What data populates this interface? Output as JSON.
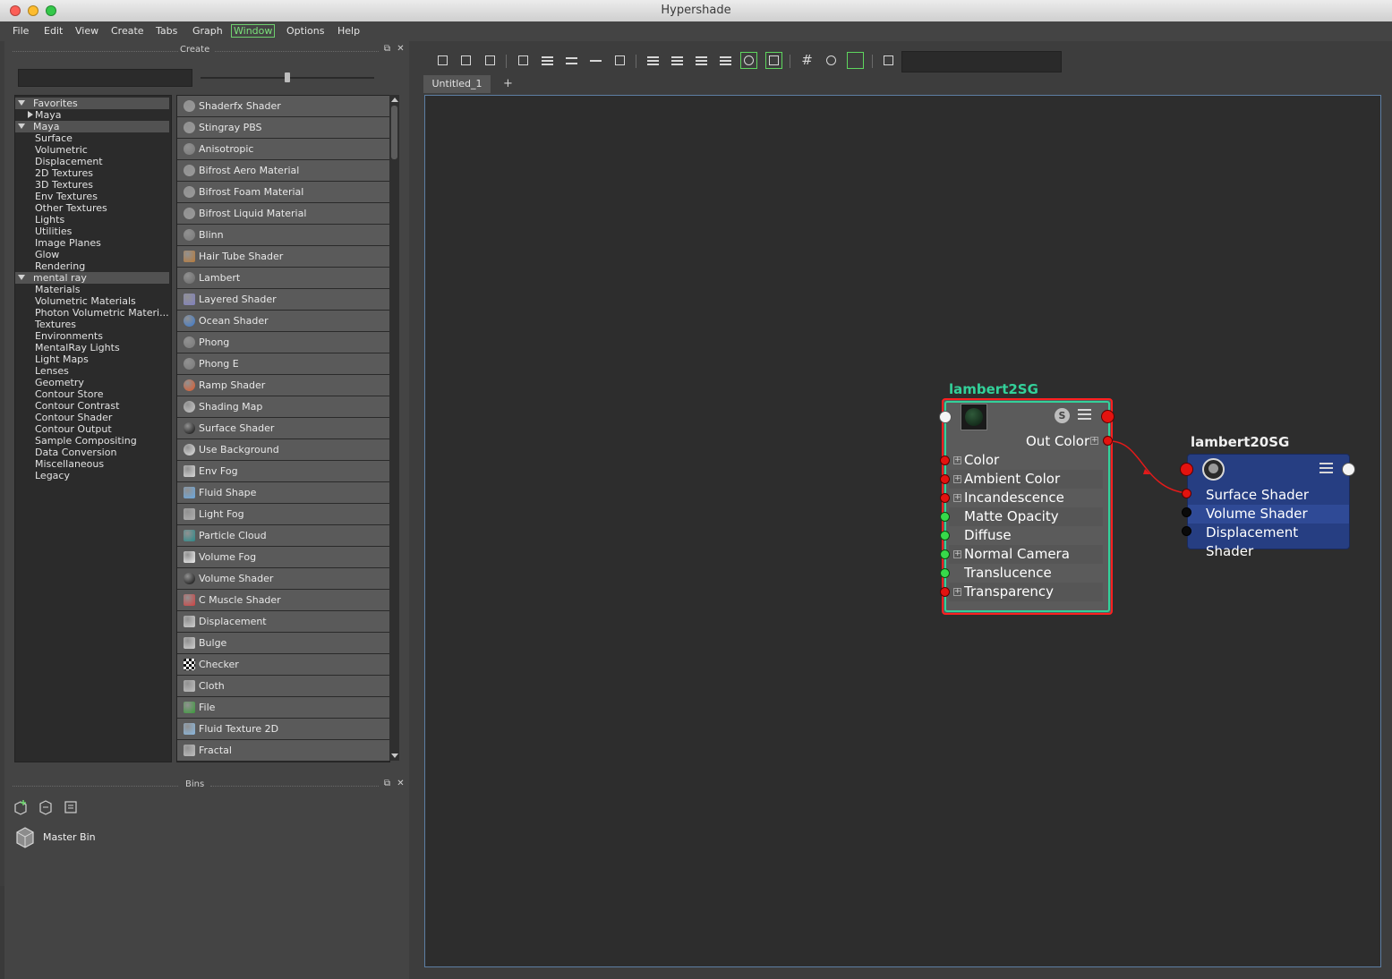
{
  "window": {
    "title": "Hypershade"
  },
  "menu": [
    "File",
    "Edit",
    "View",
    "Create",
    "Tabs",
    "Graph",
    "Window",
    "Options",
    "Help"
  ],
  "create_panel": {
    "title": "Create",
    "tree": [
      {
        "label": "Favorites",
        "level": 0,
        "expanded": true
      },
      {
        "label": "Maya",
        "level": 1,
        "expanded": false
      },
      {
        "label": "Maya",
        "level": 0,
        "expanded": true
      },
      {
        "label": "Surface",
        "level": 1
      },
      {
        "label": "Volumetric",
        "level": 1
      },
      {
        "label": "Displacement",
        "level": 1
      },
      {
        "label": "2D Textures",
        "level": 1
      },
      {
        "label": "3D Textures",
        "level": 1
      },
      {
        "label": "Env Textures",
        "level": 1
      },
      {
        "label": "Other Textures",
        "level": 1
      },
      {
        "label": "Lights",
        "level": 1
      },
      {
        "label": "Utilities",
        "level": 1
      },
      {
        "label": "Image Planes",
        "level": 1
      },
      {
        "label": "Glow",
        "level": 1
      },
      {
        "label": "Rendering",
        "level": 1
      },
      {
        "label": "mental ray",
        "level": 0,
        "expanded": true
      },
      {
        "label": "Materials",
        "level": 1
      },
      {
        "label": "Volumetric Materials",
        "level": 1
      },
      {
        "label": "Photon Volumetric Materi...",
        "level": 1
      },
      {
        "label": "Textures",
        "level": 1
      },
      {
        "label": "Environments",
        "level": 1
      },
      {
        "label": "MentalRay Lights",
        "level": 1
      },
      {
        "label": "Light Maps",
        "level": 1
      },
      {
        "label": "Lenses",
        "level": 1
      },
      {
        "label": "Geometry",
        "level": 1
      },
      {
        "label": "Contour Store",
        "level": 1
      },
      {
        "label": "Contour Contrast",
        "level": 1
      },
      {
        "label": "Contour Shader",
        "level": 1
      },
      {
        "label": "Contour Output",
        "level": 1
      },
      {
        "label": "Sample Compositing",
        "level": 1
      },
      {
        "label": "Data Conversion",
        "level": 1
      },
      {
        "label": "Miscellaneous",
        "level": 1
      },
      {
        "label": "Legacy",
        "level": 1
      }
    ],
    "items": [
      {
        "label": "Shaderfx Shader",
        "icon": "sphere-icon",
        "color": "#9a9a9a"
      },
      {
        "label": "Stingray PBS",
        "icon": "sphere-icon",
        "color": "#9a9a9a"
      },
      {
        "label": "Anisotropic",
        "icon": "sphere-icon",
        "color": "#7a7a7a"
      },
      {
        "label": "Bifrost Aero Material",
        "icon": "sphere-icon",
        "color": "#9a9a9a"
      },
      {
        "label": "Bifrost Foam Material",
        "icon": "sphere-icon",
        "color": "#9a9a9a"
      },
      {
        "label": "Bifrost Liquid Material",
        "icon": "sphere-icon",
        "color": "#9a9a9a"
      },
      {
        "label": "Blinn",
        "icon": "sphere-icon",
        "color": "#7a7a7a"
      },
      {
        "label": "Hair Tube Shader",
        "icon": "hair-icon",
        "color": "#b87a3a"
      },
      {
        "label": "Lambert",
        "icon": "sphere-icon",
        "color": "#6a6a6a"
      },
      {
        "label": "Layered Shader",
        "icon": "layered-icon",
        "color": "#8080c0"
      },
      {
        "label": "Ocean Shader",
        "icon": "ocean-icon",
        "color": "#3a7ad0"
      },
      {
        "label": "Phong",
        "icon": "sphere-icon",
        "color": "#7a7a7a"
      },
      {
        "label": "Phong E",
        "icon": "sphere-icon",
        "color": "#7a7a7a"
      },
      {
        "label": "Ramp Shader",
        "icon": "ramp-icon",
        "color": "#e05a2a"
      },
      {
        "label": "Shading Map",
        "icon": "sphere-icon",
        "color": "#c8c8c8"
      },
      {
        "label": "Surface Shader",
        "icon": "sphere-icon",
        "color": "#0a0a0a"
      },
      {
        "label": "Use Background",
        "icon": "sphere-icon",
        "color": "#e0e0e0"
      },
      {
        "label": "Env Fog",
        "icon": "fog-icon",
        "color": "#d8d8d8"
      },
      {
        "label": "Fluid Shape",
        "icon": "fluid-icon",
        "color": "#6aa8e0"
      },
      {
        "label": "Light Fog",
        "icon": "fog-icon",
        "color": "#b0b0b0"
      },
      {
        "label": "Particle Cloud",
        "icon": "cloud-icon",
        "color": "#2a8a8a"
      },
      {
        "label": "Volume Fog",
        "icon": "fog-icon",
        "color": "#f0f0f0"
      },
      {
        "label": "Volume Shader",
        "icon": "sphere-icon",
        "color": "#0a0a0a"
      },
      {
        "label": "C Muscle Shader",
        "icon": "muscle-icon",
        "color": "#d04040"
      },
      {
        "label": "Displacement",
        "icon": "displace-icon",
        "color": "#d0d0d0"
      },
      {
        "label": "Bulge",
        "icon": "bulge-icon",
        "color": "#d0d0d0"
      },
      {
        "label": "Checker",
        "icon": "checker-icon",
        "color": "#ffffff"
      },
      {
        "label": "Cloth",
        "icon": "cloth-icon",
        "color": "#c0c0c0"
      },
      {
        "label": "File",
        "icon": "file-icon",
        "color": "#3a9a3a"
      },
      {
        "label": "Fluid Texture 2D",
        "icon": "fluid-icon",
        "color": "#8ab8e0"
      },
      {
        "label": "Fractal",
        "icon": "fractal-icon",
        "color": "#c0c0c0"
      }
    ]
  },
  "bins_panel": {
    "title": "Bins",
    "master_bin": "Master Bin"
  },
  "graph": {
    "tab": "Untitled_1",
    "lambert_node": {
      "title": "lambert2SG",
      "output": "Out Color",
      "attributes": [
        {
          "label": "Color",
          "port": "red",
          "plus": true
        },
        {
          "label": "Ambient Color",
          "port": "red",
          "plus": true
        },
        {
          "label": "Incandescence",
          "port": "red",
          "plus": true
        },
        {
          "label": "Matte Opacity",
          "port": "green",
          "plus": false
        },
        {
          "label": "Diffuse",
          "port": "green",
          "plus": false
        },
        {
          "label": "Normal Camera",
          "port": "green",
          "plus": true
        },
        {
          "label": "Translucence",
          "port": "green",
          "plus": false
        },
        {
          "label": "Transparency",
          "port": "red",
          "plus": true
        }
      ],
      "swatch_badge": "S"
    },
    "sg_node": {
      "title": "lambert20SG",
      "attributes": [
        "Surface Shader",
        "Volume Shader",
        "Displacement Shader"
      ]
    }
  },
  "colors": {
    "accent_green": "#33d19a",
    "selection_red": "#ff2020",
    "sg_blue": "#263e82"
  }
}
